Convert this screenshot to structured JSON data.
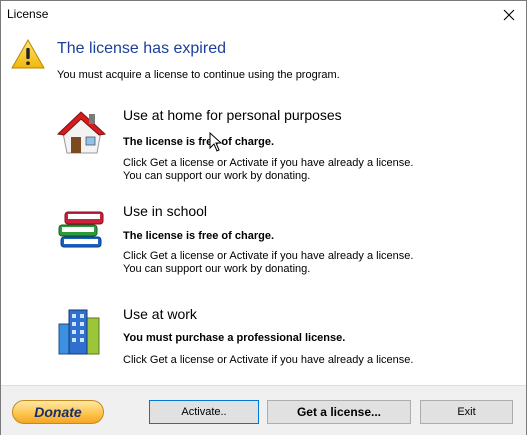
{
  "window": {
    "title": "License"
  },
  "header": {
    "title": "The license has expired",
    "subtitle": "You must acquire a license to continue using the program."
  },
  "sections": [
    {
      "icon": "house-icon",
      "title": "Use at home for personal purposes",
      "bold": "The license is free of charge.",
      "lines": [
        "Click Get a license or Activate if you have already a license.",
        "You can support our work by donating."
      ]
    },
    {
      "icon": "books-icon",
      "title": "Use in school",
      "bold": "The license is free of charge.",
      "lines": [
        "Click Get a license or Activate if you have already a license.",
        "You can support our work by donating."
      ]
    },
    {
      "icon": "office-building-icon",
      "title": "Use at work",
      "bold": "You must purchase a professional license.",
      "lines": [
        "Click Get a license or Activate if you have already a license."
      ]
    }
  ],
  "footer": {
    "donate_label": "Donate",
    "activate_label": "Activate..",
    "get_license_label": "Get a license...",
    "exit_label": "Exit"
  },
  "colors": {
    "heading": "#1b3f9a",
    "donate": "#fdc650",
    "focus": "#0078d7"
  }
}
